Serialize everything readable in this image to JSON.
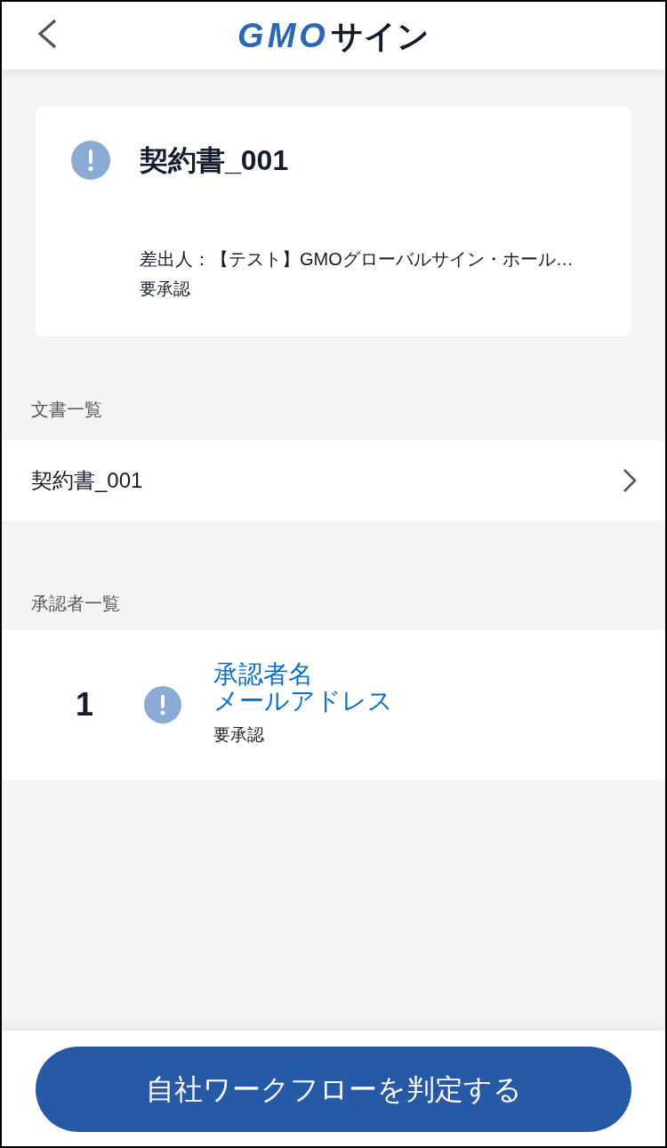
{
  "header": {
    "logo": {
      "brand": "GMO",
      "product": "サイン"
    }
  },
  "summary_card": {
    "title": "契約書_001",
    "sender": "差出人：【テスト】GMOグローバルサイン・ホール…",
    "status": "要承認"
  },
  "documents": {
    "heading": "文書一覧",
    "items": [
      {
        "name": "契約書_001"
      }
    ]
  },
  "approvers": {
    "heading": "承認者一覧",
    "items": [
      {
        "number": "1",
        "name": "承認者名",
        "email": "メールアドレス",
        "status": "要承認"
      }
    ]
  },
  "footer": {
    "button": "自社ワークフローを判定する"
  }
}
